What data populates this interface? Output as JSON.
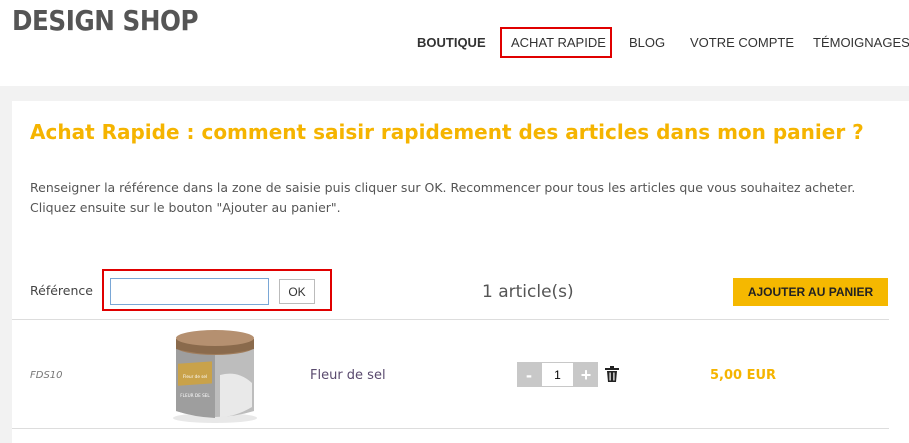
{
  "header": {
    "logo": "DESIGN SHOP",
    "nav": [
      {
        "label": "BOUTIQUE"
      },
      {
        "label": "ACHAT RAPIDE"
      },
      {
        "label": "BLOG"
      },
      {
        "label": "VOTRE COMPTE"
      },
      {
        "label": "TÉMOIGNAGES"
      }
    ]
  },
  "main": {
    "title": "Achat Rapide : comment saisir rapidement des articles dans mon panier ?",
    "intro": "Renseigner la référence dans la zone de saisie puis cliquer sur OK.  Recommencer pour tous les articles que vous souhaitez acheter. Cliquez ensuite sur le bouton \"Ajouter au panier\".",
    "reference_label": "Référence",
    "reference_value": "",
    "ok_label": "OK",
    "article_count": "1 article(s)",
    "add_to_cart_label": "AJOUTER AU PANIER"
  },
  "cart": {
    "items": [
      {
        "sku": "FDS10",
        "name": "Fleur de sel",
        "quantity": "1",
        "minus": "-",
        "plus": "+",
        "price": "5,00 EUR",
        "jar_label": "FLEUR DE SEL",
        "jar_brand": "Fleur de sel"
      }
    ]
  },
  "colors": {
    "accent": "#f5b400",
    "highlight": "#e00000",
    "product_name": "#5a4a6e"
  },
  "icons": {
    "delete": "trash-icon"
  }
}
